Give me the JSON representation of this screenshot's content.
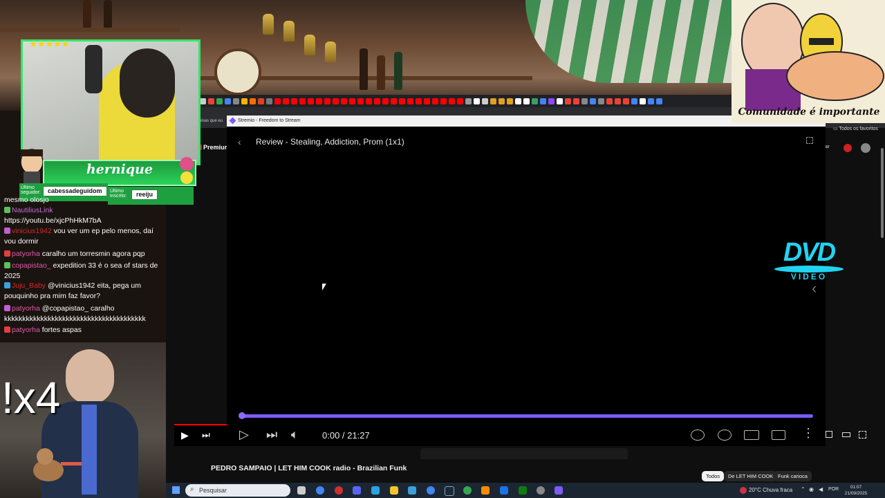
{
  "stremio": {
    "window_title": "Stremio - Freedom to Stream",
    "video_title": "Review - Stealing, Addiction, Prom (1x1)",
    "time": "0:00 / 21:27",
    "progress": 0.0
  },
  "stream_overlay": {
    "streamer_name": "hernique",
    "last_follower_label": "Último seguidor:",
    "last_follower": "cabessadeguidom",
    "last_sub_label": "Último inscrito:",
    "last_sub": "reeiju",
    "rating_stars": 5,
    "multiplier": "!x4",
    "cartoon_caption": "Comunidade é importante",
    "dvd_logo": {
      "top": "DVD",
      "bottom": "VIDEO"
    }
  },
  "chat": [
    {
      "user": "",
      "text": "mesmo olosjo",
      "user_color": "#ffffff"
    },
    {
      "user": "NautiliusLink",
      "text": "",
      "user_color": "#c46cd8"
    },
    {
      "user": "",
      "text": "https://youtu.be/xjcPhHkM7bA",
      "user_color": "#ffffff"
    },
    {
      "user": "vinicius1942",
      "text": "vou ver um ep pelo menos, daí vou dormir",
      "user_color": "#d42a2a"
    },
    {
      "user": "patyorha",
      "text": "caralho um torresmin agora pqp",
      "user_color": "#e05aa8"
    },
    {
      "user": "copapistao_",
      "text": "expedition 33 é o sea of stars de 2025",
      "user_color": "#e05aa8"
    },
    {
      "user": "Juju_Baby",
      "text": "@vinicius1942 eita, pega um pouquinho pra mim faz favor?",
      "user_color": "#d42a2a"
    },
    {
      "user": "patyorha",
      "text": "@copapistao_ caralho kkkkkkkkkkkkkkkkkkkkkkkkkkkkkkkkkkkkkkk",
      "user_color": "#e05aa8"
    },
    {
      "user": "patyorha",
      "text": "fortes aspas",
      "user_color": "#e05aa8"
    }
  ],
  "browser": {
    "bookmarks_label": "Todos os favoritos",
    "tab_text": "coisas que eu",
    "yt_premium": "Premium",
    "yt_button_partial": "iar"
  },
  "youtube": {
    "video_title": "PEDRO SAMPAIO | LET HIM COOK radio - Brazilian Funk",
    "chips": [
      "Todos",
      "De LET HIM COOK",
      "Funk carioca"
    ]
  },
  "taskbar": {
    "search_placeholder": "Pesquisar",
    "weather": "20°C  Chuva fraca",
    "lang": "POR",
    "time": "01:07",
    "date": "21/09/2025"
  },
  "colors": {
    "accent": "#7b5bf5",
    "overlay_green": "#2ee86a",
    "dvd_cyan": "#22d3f0"
  }
}
